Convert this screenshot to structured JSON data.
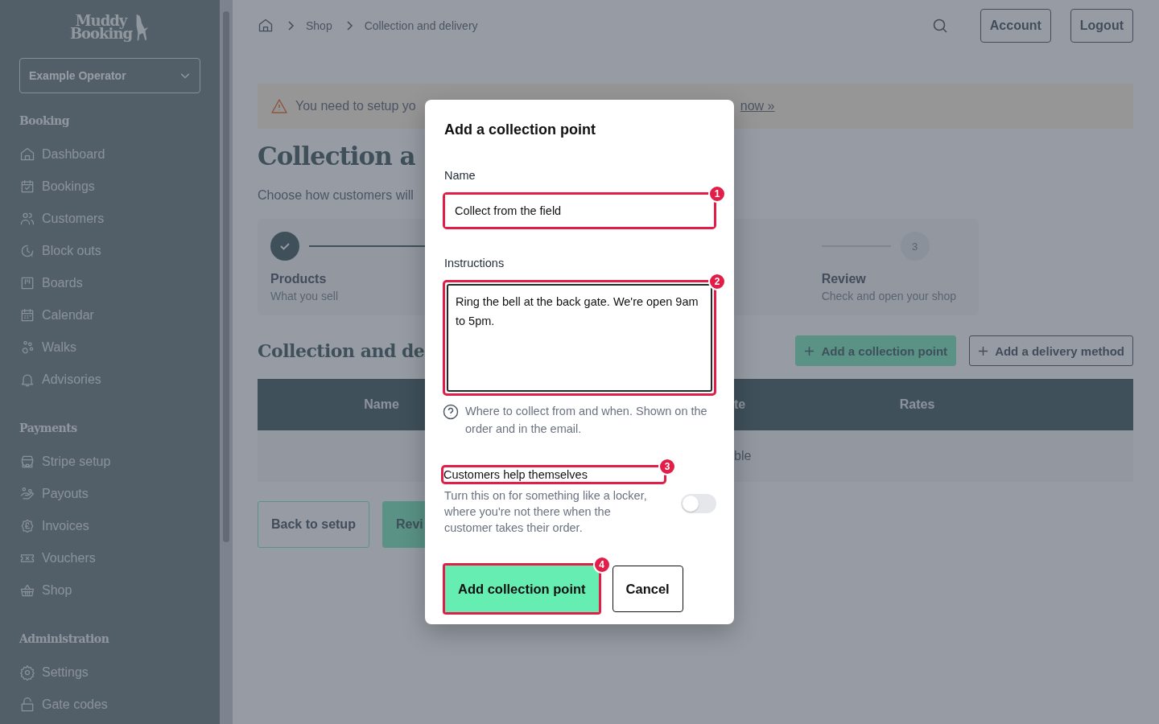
{
  "sidebar": {
    "logo": [
      "Muddy",
      "Booking"
    ],
    "operator_select": {
      "value": "Example Operator"
    },
    "sections": [
      {
        "title": "Booking",
        "items": [
          "Dashboard",
          "Bookings",
          "Customers",
          "Block outs",
          "Boards",
          "Calendar",
          "Walks",
          "Advisories"
        ]
      },
      {
        "title": "Payments",
        "items": [
          "Stripe setup",
          "Payouts",
          "Invoices",
          "Vouchers",
          "Shop"
        ]
      },
      {
        "title": "Administration",
        "items": [
          "Settings",
          "Gate codes"
        ]
      }
    ]
  },
  "topbar": {
    "breadcrumbs": [
      "Shop",
      "Collection and delivery"
    ],
    "buttons": [
      "Account",
      "Logout"
    ]
  },
  "alert": {
    "text": "You need to setup yo",
    "link": "now »"
  },
  "page": {
    "title": "Collection a",
    "subtitle": "Choose how customers will",
    "steps": [
      {
        "completed": true,
        "label": "Products",
        "description": "What you sell"
      },
      {
        "number": "3",
        "completed": false,
        "label": "Review",
        "description": "Check and open your shop"
      }
    ],
    "section_title": "Collection and de",
    "section_buttons": [
      {
        "label": "Add a collection point",
        "kind": "primary"
      },
      {
        "label": "Add a delivery method",
        "kind": "outline"
      }
    ],
    "table": {
      "columns": [
        "Name",
        "te",
        "Rates"
      ],
      "empty_message": "ble"
    },
    "footer_buttons": [
      {
        "label": "Back to setup",
        "kind": "outline"
      },
      {
        "label": "Revi",
        "kind": "primary"
      }
    ]
  },
  "modal": {
    "title": "Add a collection point",
    "fields": [
      {
        "kind": "text",
        "label": "Name",
        "value": "Collect from the field",
        "marker": "1"
      },
      {
        "kind": "textarea",
        "label": "Instructions",
        "value": "Ring the bell at the back gate. We're open 9am to 5pm.",
        "marker": "2",
        "help": "Where to collect from and when. Shown on the order and in the email."
      },
      {
        "kind": "toggle",
        "label": "Customers help themselves",
        "marker": "3",
        "description": "Turn this on for something like a locker, where you're not there when the customer takes their order.",
        "on": false
      }
    ],
    "actions": [
      {
        "label": "Add collection point",
        "kind": "primary",
        "marker": "4"
      },
      {
        "label": "Cancel",
        "kind": "outline"
      }
    ]
  }
}
